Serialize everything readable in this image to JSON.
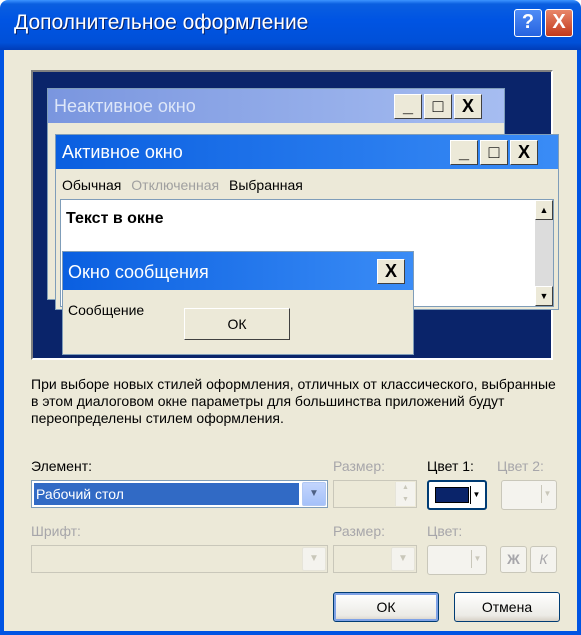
{
  "dialog": {
    "title": "Дополнительное оформление",
    "help_glyph": "?",
    "close_glyph": "X"
  },
  "preview": {
    "inactive_window_title": "Неактивное окно",
    "active_window_title": "Активное окно",
    "caption_buttons": [
      "_",
      "□",
      "X"
    ],
    "menu": {
      "normal": "Обычная",
      "disabled": "Отключенная",
      "selected": "Выбранная"
    },
    "window_text": "Текст в окне",
    "message_box": {
      "title": "Окно сообщения",
      "text": "Сообщение",
      "ok_label": "ОК"
    }
  },
  "description": "При выборе новых стилей оформления, отличных от классического, выбранные в этом диалоговом окне параметры для большинства приложений будут переопределены стилем оформления.",
  "element": {
    "label": "Элемент:",
    "selected": "Рабочий стол"
  },
  "element_size": {
    "label": "Размер:",
    "value": ""
  },
  "color1": {
    "label": "Цвет 1:",
    "value": "#0a246a"
  },
  "color2": {
    "label": "Цвет 2:"
  },
  "font": {
    "label": "Шрифт:",
    "value": ""
  },
  "font_size": {
    "label": "Размер:",
    "value": ""
  },
  "font_color": {
    "label": "Цвет:"
  },
  "bold_label": "Ж",
  "italic_label": "К",
  "buttons": {
    "ok": "ОК",
    "cancel": "Отмена"
  },
  "colors": {
    "desktop": "#0a246a",
    "selection": "#316ac5",
    "titlebar": "#0054e3"
  }
}
